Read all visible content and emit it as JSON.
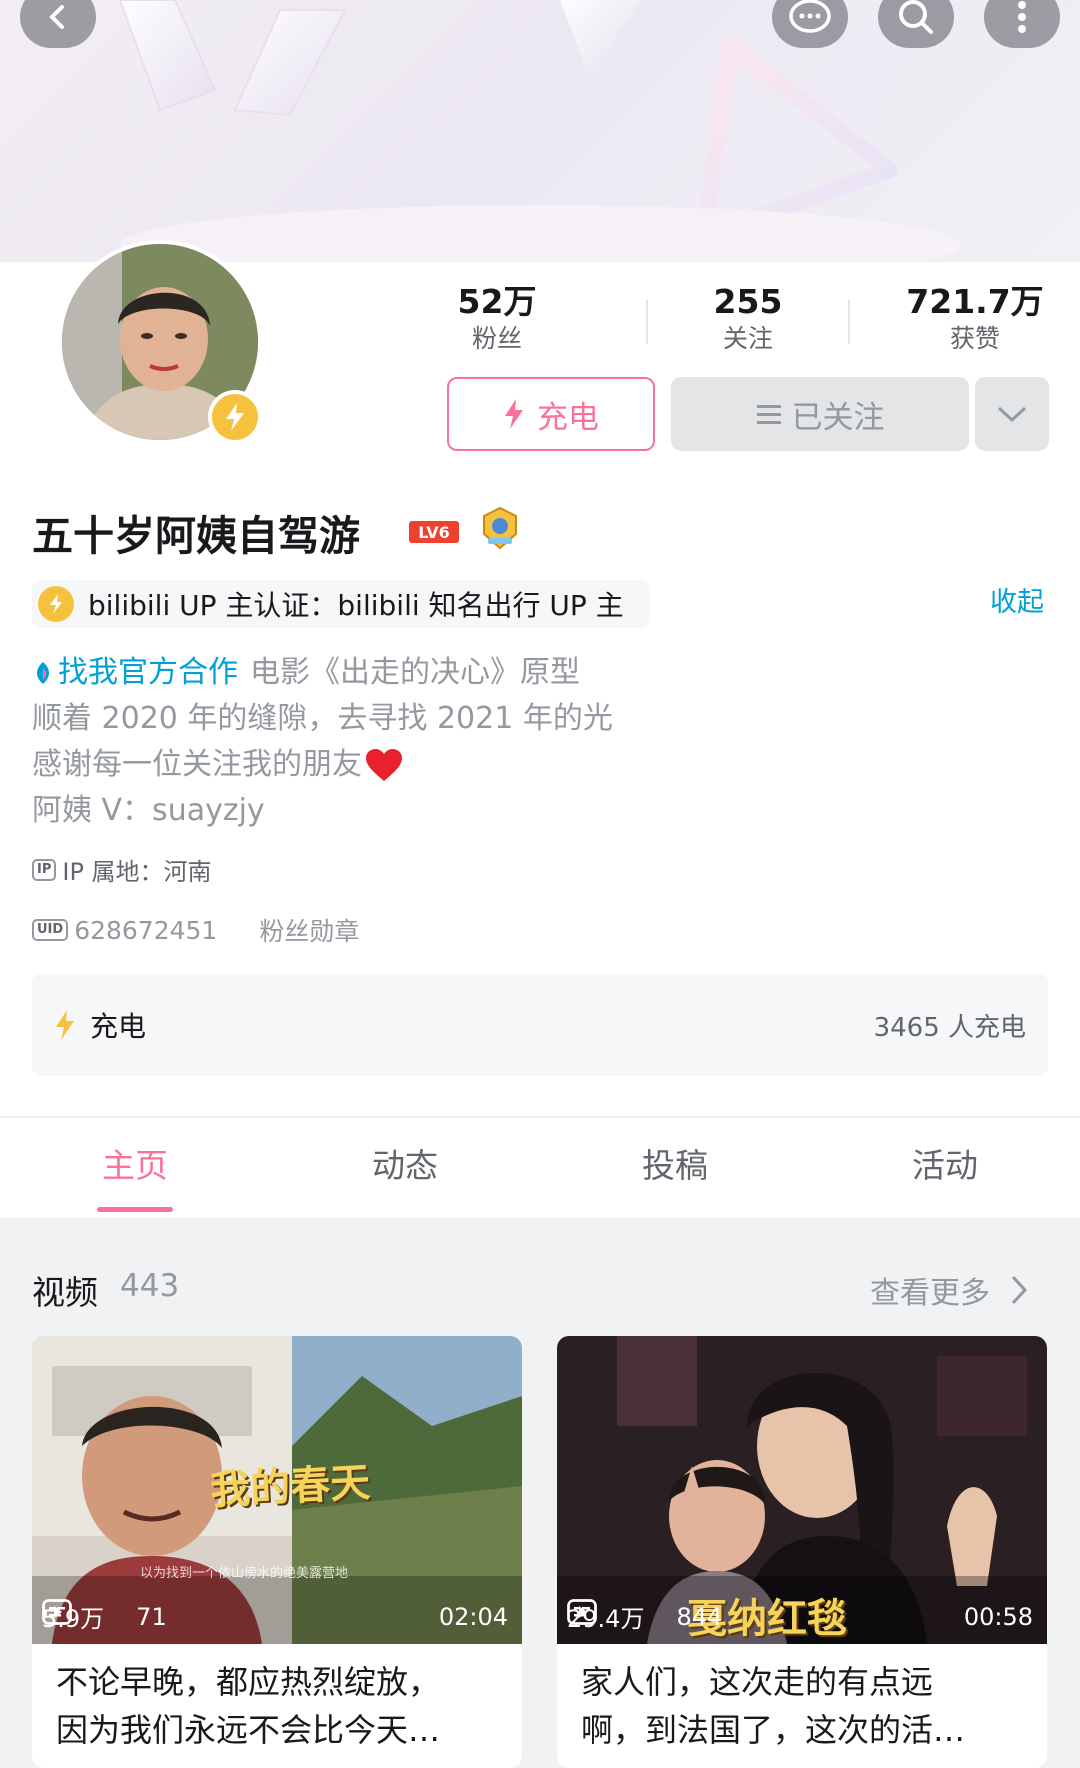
{
  "stats": [
    {
      "value": "52万",
      "label": "粉丝"
    },
    {
      "value": "255",
      "label": "关注"
    },
    {
      "value": "721.7万",
      "label": "获赞"
    }
  ],
  "actions": {
    "charge_label": "充电",
    "follow_label": "已关注"
  },
  "profile": {
    "name": "五十岁阿姨自驾游",
    "level": "LV6",
    "certification": "bilibili UP 主认证：bilibili 知名出行 UP 主",
    "collapse_label": "收起",
    "bio_link": "找我官方合作",
    "bio_lines": [
      "电影《出走的决心》原型",
      "顺着 2020 年的缝隙，去寻找 2021 年的光",
      "感谢每一位关注我的朋友",
      "阿姨 V：suayzjy"
    ],
    "ip_label": "IP 属地：河南",
    "ip_tag": "IP",
    "uid": "628672451",
    "uid_tag": "UID",
    "fan_medal": "粉丝勋章"
  },
  "charge_card": {
    "label": "充电",
    "count": "3465 人充电"
  },
  "tabs": [
    {
      "label": "主页",
      "active": true
    },
    {
      "label": "动态",
      "active": false
    },
    {
      "label": "投稿",
      "active": false
    },
    {
      "label": "活动",
      "active": false
    }
  ],
  "videos_section": {
    "title": "视频",
    "count": "443",
    "more": "查看更多"
  },
  "videos": [
    {
      "views": "5.9万",
      "danmaku": "71",
      "duration": "02:04",
      "overlay_text": "我的春天",
      "caption": "以为找到一个依山傍水的绝美露营地",
      "title_lines": [
        "不论早晚，都应热烈绽放，",
        "因为我们永远不会比今天…"
      ]
    },
    {
      "views": "29.4万",
      "danmaku": "844",
      "duration": "00:58",
      "overlay_text": "戛纳红毯",
      "title_lines": [
        "家人们，这次走的有点远",
        "啊，到法国了，这次的活…"
      ]
    }
  ],
  "colors": {
    "accent": "#fb7299",
    "link": "#00a1d6",
    "gold": "#f6c23e"
  },
  "icons": [
    "back-icon",
    "message-icon",
    "search-icon",
    "more-icon",
    "lightning-icon",
    "chevron-down-icon",
    "chevron-right-icon",
    "play-icon",
    "danmaku-icon",
    "heart-icon",
    "bilibili-logo-icon"
  ]
}
